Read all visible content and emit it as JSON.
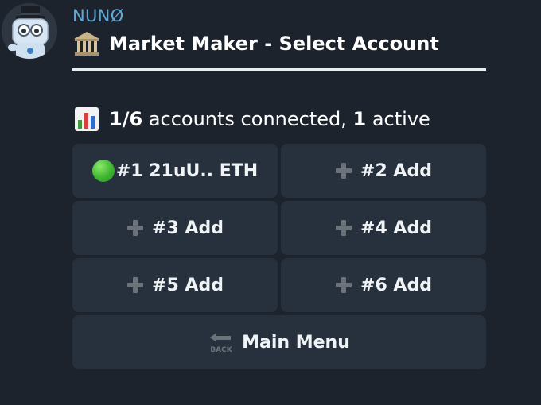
{
  "message": {
    "sender": "NUNØ",
    "title": "Market Maker - Select Account",
    "status": {
      "connected_count": "1/6",
      "connected_text": "accounts connected,",
      "active_count": "1",
      "active_text": "active"
    }
  },
  "keyboard": {
    "buttons": [
      {
        "label": "#1 21uU.. ETH",
        "icon": "green-circle-icon"
      },
      {
        "label": "#2 Add",
        "icon": "plus-icon"
      },
      {
        "label": "#3 Add",
        "icon": "plus-icon"
      },
      {
        "label": "#4 Add",
        "icon": "plus-icon"
      },
      {
        "label": "#5 Add",
        "icon": "plus-icon"
      },
      {
        "label": "#6 Add",
        "icon": "plus-icon"
      }
    ],
    "main_menu": {
      "label": "Main Menu",
      "icon": "back-arrow-icon",
      "icon_text": "BACK"
    }
  },
  "colors": {
    "background": "#1c232d",
    "button": "#27313d",
    "sender": "#5fa8d3",
    "active_dot": "#3fb532"
  }
}
